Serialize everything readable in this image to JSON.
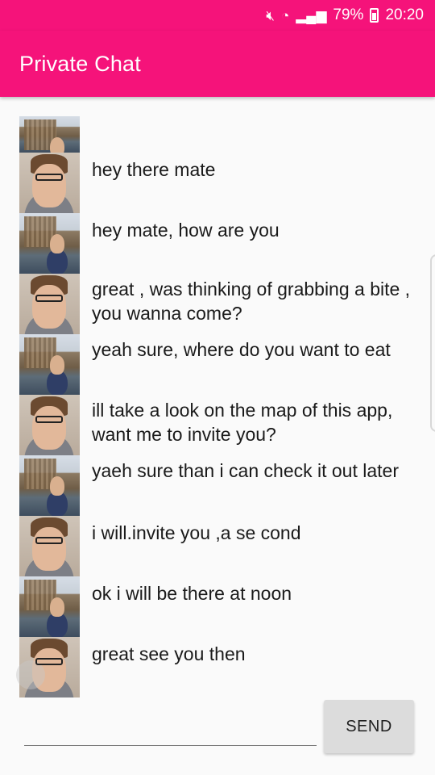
{
  "status_bar": {
    "icons": [
      "mute-icon",
      "wifi-icon",
      "signal-icon",
      "battery-icon"
    ],
    "battery": "79%",
    "time": "20:20"
  },
  "app_bar": {
    "title": "Private Chat",
    "color": "#f5137a"
  },
  "messages": [
    {
      "avatar": "london",
      "text": ""
    },
    {
      "avatar": "selfie",
      "text": "hey there mate"
    },
    {
      "avatar": "london",
      "text": "hey mate, how are you"
    },
    {
      "avatar": "selfie",
      "text": "great , was thinking of grabbing a bite , you wanna come?"
    },
    {
      "avatar": "london",
      "text": "yeah sure, where do you want to eat"
    },
    {
      "avatar": "selfie",
      "text": "ill take a look on the map of this app, want me to invite you?"
    },
    {
      "avatar": "london",
      "text": "yaeh sure than i can check it out later"
    },
    {
      "avatar": "selfie",
      "text": "i will.invite you ,a se cond"
    },
    {
      "avatar": "london",
      "text": "ok i will be there at noon"
    },
    {
      "avatar": "selfie",
      "text": "great see you then"
    }
  ],
  "compose": {
    "input_value": "",
    "input_placeholder": "",
    "send_label": "SEND"
  }
}
